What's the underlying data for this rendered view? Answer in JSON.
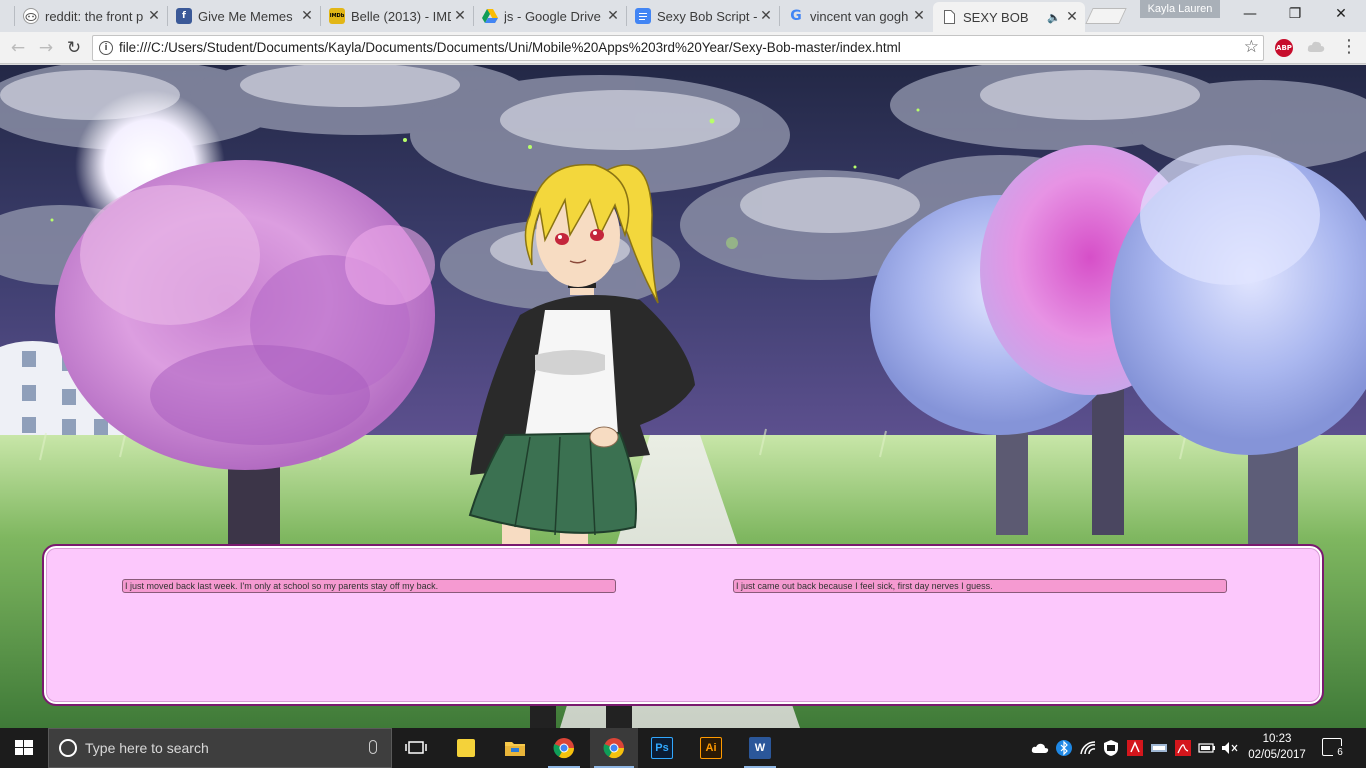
{
  "browser": {
    "tabs": [
      {
        "title": "reddit: the front p",
        "icon": "reddit-icon",
        "close": "✕"
      },
      {
        "title": "Give Me Memes",
        "icon": "facebook-icon",
        "close": "✕"
      },
      {
        "title": "Belle (2013) - IMD",
        "icon": "imdb-icon",
        "favicon_text": "IMDb",
        "close": "✕"
      },
      {
        "title": "js - Google Drive",
        "icon": "google-drive-icon",
        "close": "✕"
      },
      {
        "title": "Sexy Bob Script -",
        "icon": "google-docs-icon",
        "close": "✕"
      },
      {
        "title": "vincent van gogh",
        "icon": "google-icon",
        "favicon_text": "G",
        "close": "✕"
      },
      {
        "title": "SEXY BOB",
        "icon": "page-icon",
        "audio": "🔈",
        "close": "✕",
        "active": true
      }
    ],
    "profile_name": "Kayla Lauren",
    "window_controls": {
      "minimize": "—",
      "maximize": "❐",
      "close": "✕"
    },
    "nav": {
      "back": "←",
      "forward": "→",
      "reload": "↻"
    },
    "address": {
      "info": "i",
      "url": "file:///C:/Users/Student/Documents/Kayla/Documents/Documents/Uni/Mobile%20Apps%203rd%20Year/Sexy-Bob-master/index.html",
      "star": "☆"
    },
    "extensions": {
      "adblock": "ABP",
      "menu": "⋮"
    }
  },
  "game": {
    "choices": [
      "I just moved back last week. I'm only at school so my parents stay off my back.",
      "I just came out back because I feel sick, first day nerves I guess."
    ],
    "colors": {
      "dialog_bg": "#fcc8fc",
      "dialog_border": "#7a1a6f",
      "choice_bg": "#f59ad1"
    }
  },
  "taskbar": {
    "search_placeholder": "Type here to search",
    "apps": [
      {
        "name": "task-view-icon"
      },
      {
        "name": "sticky-notes-icon"
      },
      {
        "name": "file-explorer-icon"
      },
      {
        "name": "chrome-icon"
      },
      {
        "name": "chrome-active-icon"
      },
      {
        "name": "photoshop-icon",
        "label": "Ps"
      },
      {
        "name": "illustrator-icon",
        "label": "Ai"
      },
      {
        "name": "word-icon",
        "label": "W"
      }
    ],
    "clock": {
      "time": "10:23",
      "date": "02/05/2017"
    },
    "notification_count": "6"
  }
}
